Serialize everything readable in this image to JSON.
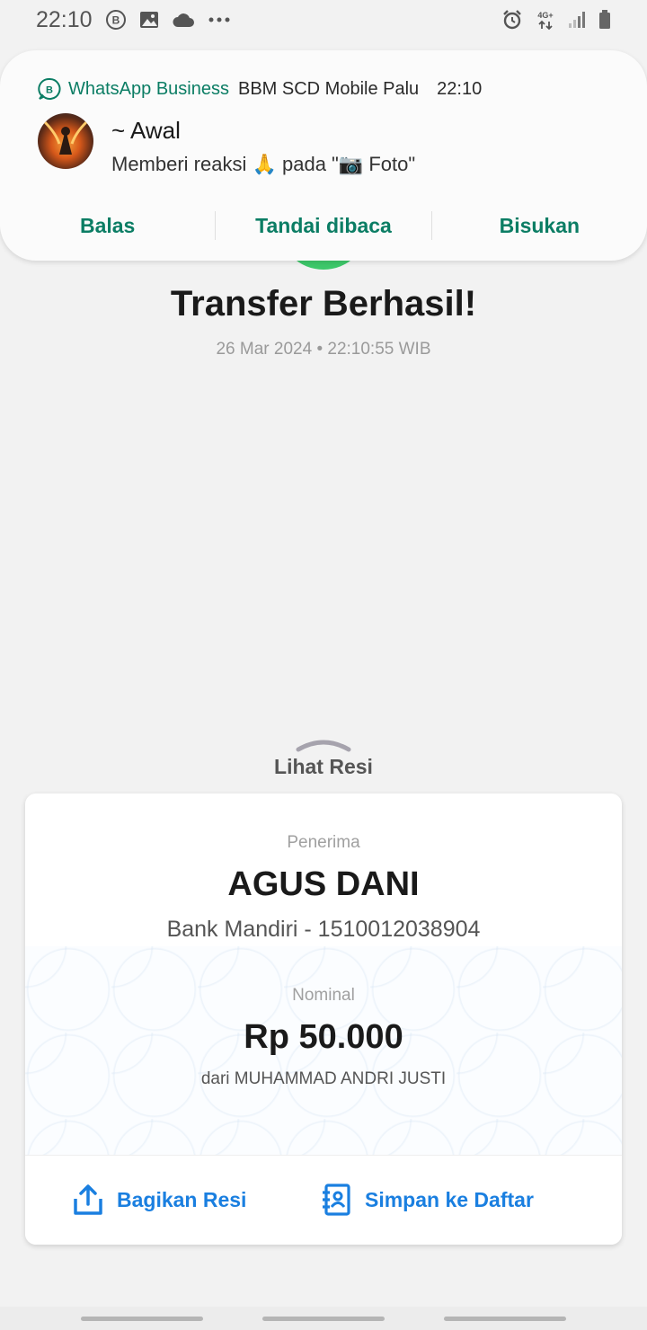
{
  "status_bar": {
    "time": "22:10",
    "icons": [
      "whatsapp-business-icon",
      "image-icon",
      "cloud-icon",
      "more-icon"
    ],
    "right_icons": [
      "alarm-icon",
      "network-4g-plus-icon",
      "signal-icon",
      "battery-icon"
    ],
    "network_label": "4G+"
  },
  "notification": {
    "app_name": "WhatsApp Business",
    "channel": "BBM SCD Mobile Palu",
    "time": "22:10",
    "sender": "~ Awal",
    "message": "Memberi reaksi 🙏 pada \"📷 Foto\"",
    "actions": [
      "Balas",
      "Tandai dibaca",
      "Bisukan"
    ],
    "accent_color": "#0b7d64"
  },
  "transfer": {
    "title": "Transfer Berhasil!",
    "datetime": "26 Mar 2024 • 22:10:55 WIB"
  },
  "receipt": {
    "toggle_label": "Lihat Resi",
    "recipient_label": "Penerima",
    "recipient_name": "AGUS DANI",
    "recipient_bank": "Bank Mandiri - 1510012038904",
    "amount_label": "Nominal",
    "amount": "Rp 50.000",
    "sender": "dari MUHAMMAD ANDRI JUSTI",
    "share_label": "Bagikan Resi",
    "save_label": "Simpan ke Daftar",
    "accent_color": "#1a7fe0"
  }
}
